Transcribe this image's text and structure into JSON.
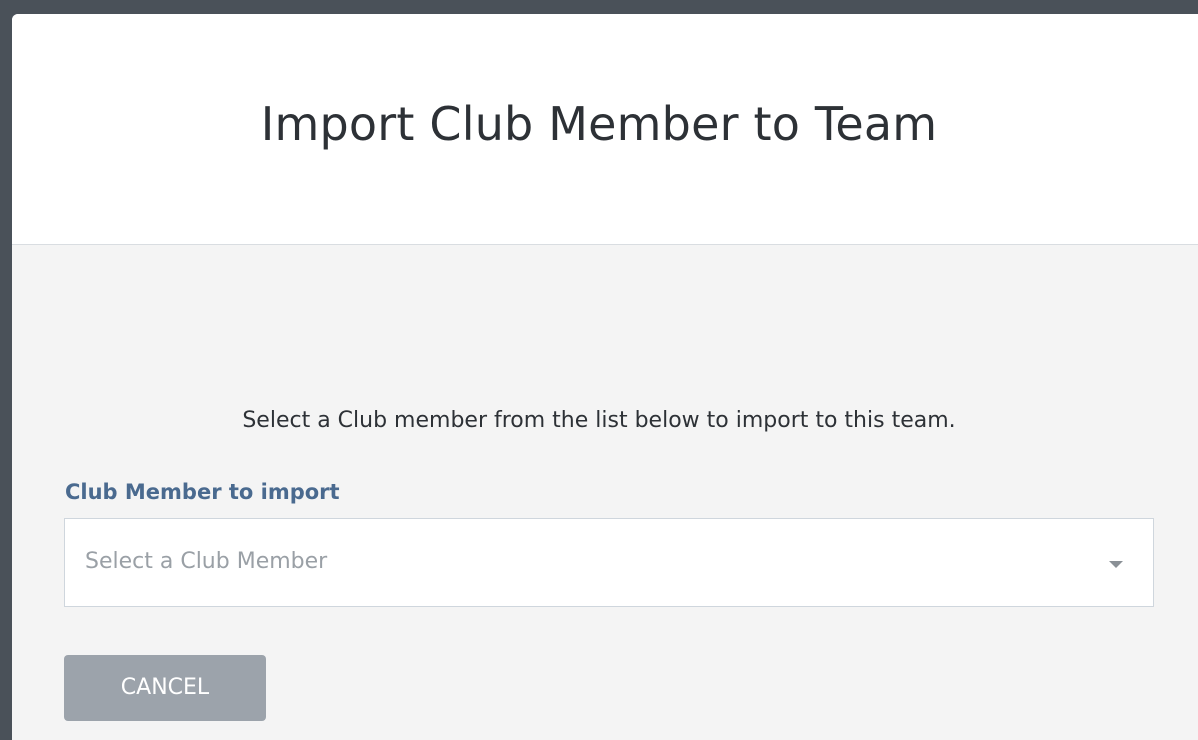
{
  "modal": {
    "title": "Import Club Member to Team",
    "instruction": "Select a Club member from the list below to import to this team.",
    "field_label": "Club Member to import",
    "select": {
      "placeholder": "Select a Club Member",
      "selected_value": ""
    },
    "cancel_label": "CANCEL"
  },
  "icons": {
    "select_caret": "chevron-down-icon"
  },
  "colors": {
    "backdrop": "#4a5159",
    "header_bg": "#ffffff",
    "body_bg": "#f4f4f4",
    "label_color": "#4a6a8f",
    "button_bg": "#9ca3ab"
  }
}
